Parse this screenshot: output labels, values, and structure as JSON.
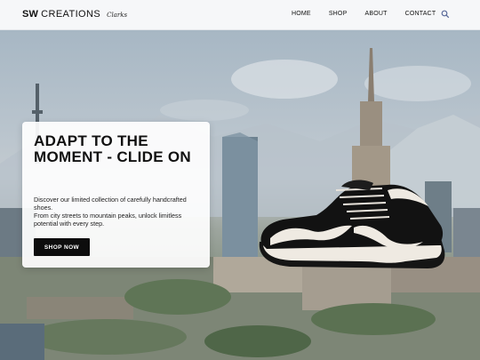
{
  "nav": {
    "brand_bold": "SW",
    "brand_light": "CREATIONS",
    "brand_signature": "Clarks",
    "links": [
      "HOME",
      "SHOP",
      "ABOUT",
      "CONTACT"
    ],
    "search_icon": "search-icon"
  },
  "hero": {
    "title": "ADAPT TO THE MOMENT - CLIDE ON",
    "description_line1": "Discover our limited collection of carefully handcrafted shoes.",
    "description_line2": "From city streets to mountain peaks, unlock limitless potential with every step.",
    "button_label": "SHOP NOW"
  },
  "colors": {
    "button_bg": "#0d0d0d",
    "nav_bg": "#f6f7f9",
    "search_icon": "#5a6a9a"
  }
}
